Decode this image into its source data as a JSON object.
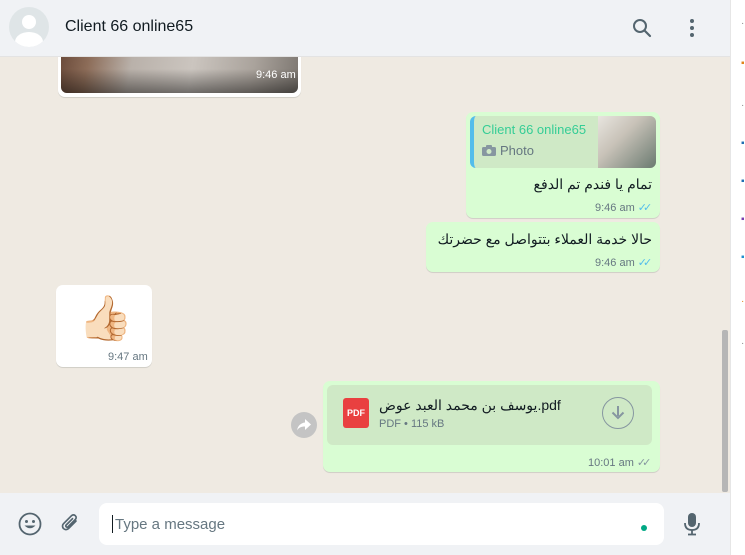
{
  "header": {
    "contact_name": "Client 66 online65",
    "search_icon": "search-icon",
    "menu_icon": "more-vertical-icon"
  },
  "messages": {
    "photo": {
      "time": "9:46 am"
    },
    "reply": {
      "quoted_name": "Client 66 online65",
      "quoted_type": "Photo",
      "text": "تمام يا فندم تم الدفع",
      "time": "9:46 am"
    },
    "text2": {
      "text": "حالا خدمة العملاء بتتواصل مع حضرتك",
      "time": "9:46 am"
    },
    "thumbs": {
      "emoji": "👍🏻",
      "time": "9:47 am"
    },
    "document": {
      "file_icon_label": "PDF",
      "file_name": "يوسف بن محمد العبد عوض.pdf",
      "meta": "PDF • 115 kB",
      "time": "10:01 am"
    }
  },
  "footer": {
    "placeholder": "Type a message",
    "emoji_icon": "emoji-icon",
    "attach_icon": "paperclip-icon",
    "mic_icon": "microphone-icon"
  },
  "colors": {
    "outgoing_bubble": "#d9fdd3",
    "incoming_bubble": "#ffffff",
    "chat_background": "#efeae2",
    "read_ticks": "#53bdeb",
    "accent": "#00a884"
  }
}
